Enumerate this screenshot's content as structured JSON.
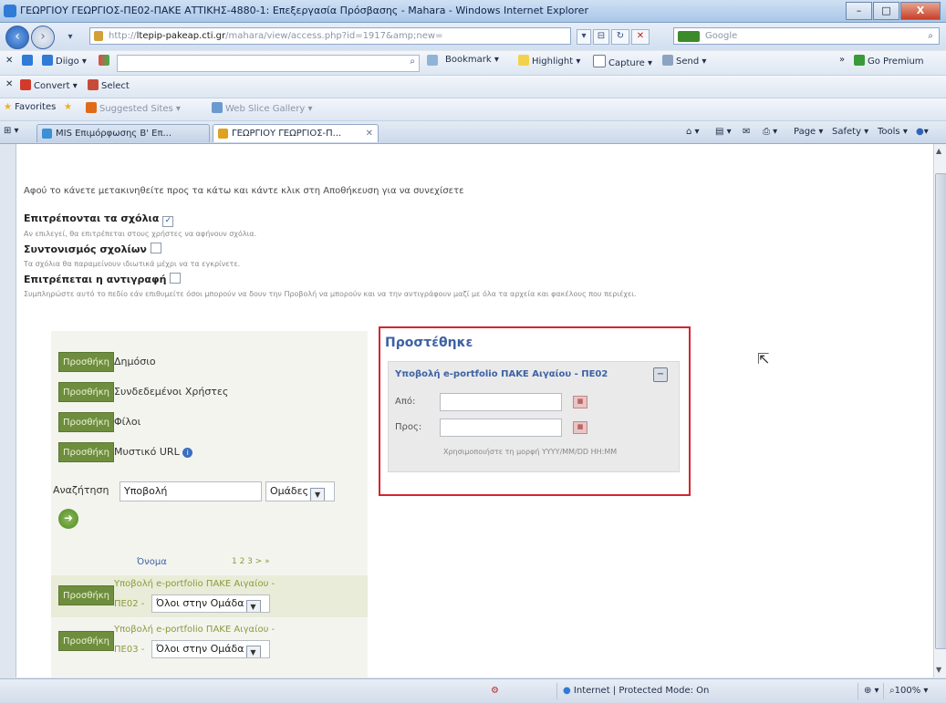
{
  "window": {
    "title": "ΓΕΩΡΓΙΟΥ ΓΕΩΡΓΙΟΣ-ΠΕ02-ΠΑΚΕ ΑΤΤΙΚΗΣ-4880-1: Επεξεργασία Πρόσβασης - Mahara - Windows Internet Explorer",
    "minimize": "–",
    "maximize": "□",
    "close": "X"
  },
  "address": {
    "url_prefix": "http://",
    "url_host": "ltepip-pakeap.cti.gr",
    "url_rest": "/mahara/view/access.php?id=1917&amp;new=",
    "search_placeholder": "Google",
    "search_icon": "magnifier-icon"
  },
  "toolbar1": {
    "digo": "Diigo ▾",
    "bookmark": "Bookmark ▾",
    "highlight": "Highlight ▾",
    "capture": "Capture ▾",
    "send": "Send ▾",
    "premium": "Go Premium",
    "more": "»"
  },
  "toolbar2": {
    "convert": "Convert ▾",
    "select": "Select"
  },
  "favorites": {
    "label": "Favorites",
    "suggested": "Suggested Sites ▾",
    "webslice": "Web Slice Gallery ▾"
  },
  "tabs": [
    {
      "label": "MIS Επιμόρφωσης Β' Επ..."
    },
    {
      "label": "ΓΕΩΡΓΙΟΥ ΓΕΩΡΓΙΟΣ-Π..."
    }
  ],
  "commands": {
    "page": "Page ▾",
    "safety": "Safety ▾",
    "tools": "Tools ▾",
    "help": "▾"
  },
  "content": {
    "instruction": "Αφού το κάνετε μετακινηθείτε προς τα κάτω και κάντε κλικ στη Αποθήκευση για να συνεχίσετε",
    "allow_comments": "Επιτρέπονται τα σχόλια",
    "allow_comments_help": "Αν επιλεγεί, θα επιτρέπεται στους χρήστες να αφήνουν σχόλια.",
    "moderate_comments": "Συντονισμός σχολίων",
    "moderate_comments_help": "Τα σχόλια θα παραμείνουν ιδιωτικά μέχρι να τα εγκρίνετε.",
    "allow_copy": "Επιτρέπεται η αντιγραφή",
    "allow_copy_help": "Συμπληρώστε αυτό το πεδίο εάν επιθυμείτε όσοι μπορούν να δουν την Προβολή να μπορούν και να την αντιγράφουν μαζί με όλα τα αρχεία και φακέλους που περιέχει."
  },
  "left": {
    "add_label": "Προσθήκη",
    "options": [
      "Δημόσιο",
      "Συνδεδεμένοι Χρήστες",
      "Φίλοι",
      "Μυστικό URL"
    ],
    "search_label": "Αναζήτηση",
    "search_value": "Υποβολή",
    "search_type": "Ομάδες",
    "results_header": "Όνομα",
    "pagination": "1 2 3  > »",
    "results": [
      {
        "name_line1": "Υποβολή e-portfolio ΠΑΚΕ Αιγαίου -",
        "name_line2": "ΠΕ02 -",
        "role": "Όλοι στην Ομάδα"
      },
      {
        "name_line1": "Υποβολή e-portfolio ΠΑΚΕ Αιγαίου -",
        "name_line2": "ΠΕ03 -",
        "role": "Όλοι στην Ομάδα"
      }
    ]
  },
  "right": {
    "title": "Προστέθηκε",
    "item_title": "Υποβολή e-portfolio ΠΑΚΕ Αιγαίου - ΠΕ02",
    "from_label": "Από:",
    "to_label": "Προς:",
    "date_hint": "Χρησιμοποιήστε τη μορφή YYYY/MM/DD HH:MM"
  },
  "status": {
    "zone": "Internet | Protected Mode: On",
    "zoom": "100%"
  },
  "colors": {
    "add_button": "#6e8e3d",
    "highlight_box": "#d5242f",
    "title_blue": "#3d62a4"
  }
}
